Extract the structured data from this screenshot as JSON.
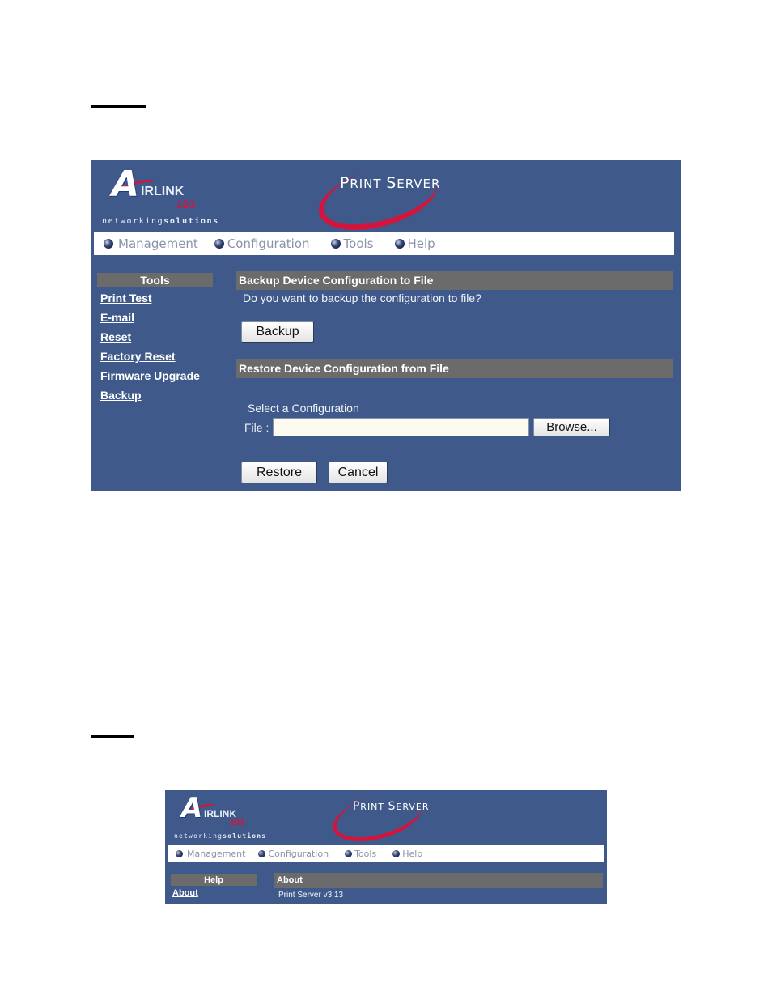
{
  "screenshot1": {
    "brand": {
      "logo_a": "A",
      "logo_text": "IRLINK",
      "logo_number": "101",
      "tagline_light": "networking",
      "tagline_bold": "solutions",
      "product_title_p": "P",
      "product_title_rint": "RINT ",
      "product_title_s": "S",
      "product_title_erver": "ERVER"
    },
    "nav": [
      {
        "label": "Management"
      },
      {
        "label": "Configuration"
      },
      {
        "label": "Tools"
      },
      {
        "label": "Help"
      }
    ],
    "sidebar": {
      "heading": "Tools",
      "links": [
        {
          "label": "Print Test"
        },
        {
          "label": "E-mail"
        },
        {
          "label": "Reset"
        },
        {
          "label": "Factory Reset"
        },
        {
          "label": "Firmware Upgrade"
        },
        {
          "label": "Backup"
        }
      ]
    },
    "backup_section": {
      "heading": "Backup Device Configuration to File",
      "prompt": "Do you want to backup the configuration to file?",
      "button": "Backup"
    },
    "restore_section": {
      "heading": "Restore Device Configuration from File",
      "select_label": "Select a Configuration",
      "file_label": "File :",
      "file_value": "",
      "browse_button": "Browse...",
      "restore_button": "Restore",
      "cancel_button": "Cancel"
    }
  },
  "screenshot2": {
    "brand": {
      "logo_a": "A",
      "logo_text": "IRLINK",
      "logo_number": "101",
      "tagline_light": "networking",
      "tagline_bold": "solutions",
      "product_title_p": "P",
      "product_title_rint": "RINT ",
      "product_title_s": "S",
      "product_title_erver": "ERVER"
    },
    "nav": [
      {
        "label": "Management"
      },
      {
        "label": "Configuration"
      },
      {
        "label": "Tools"
      },
      {
        "label": "Help"
      }
    ],
    "sidebar": {
      "heading": "Help",
      "links": [
        {
          "label": "About"
        }
      ]
    },
    "about_section": {
      "heading": "About",
      "version_text": "Print Server v3.13"
    }
  }
}
